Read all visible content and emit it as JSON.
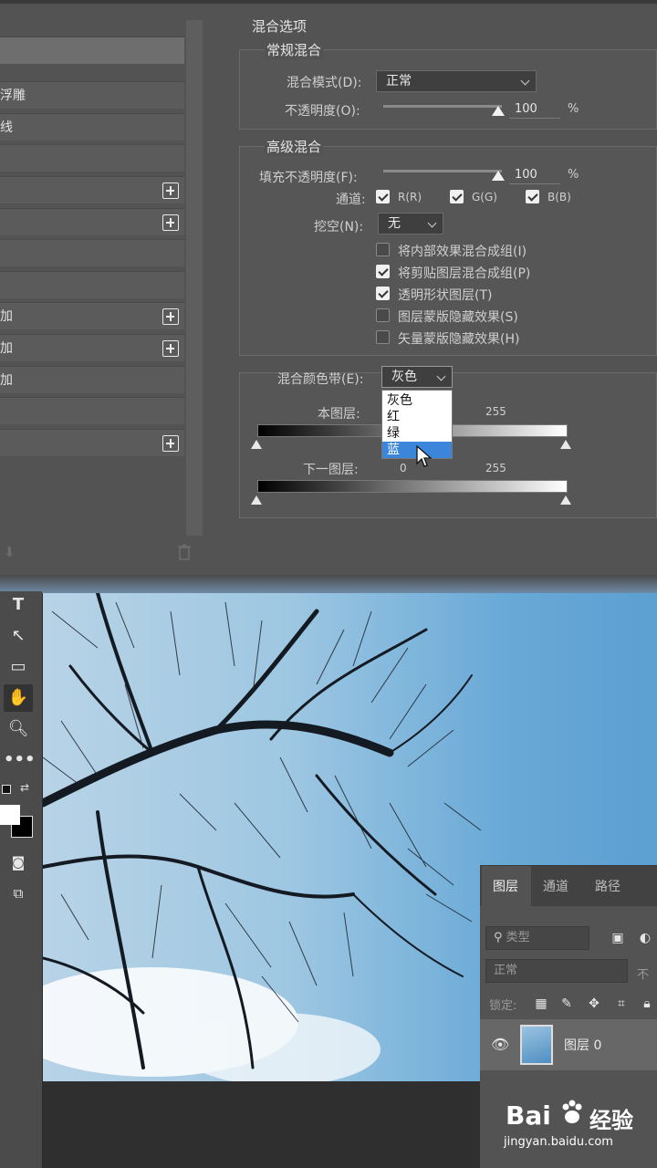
{
  "style_list": {
    "items": [
      {
        "label": "",
        "plus": false,
        "selected": true
      },
      {
        "label": "浮雕",
        "plus": false
      },
      {
        "label": "线",
        "plus": false
      },
      {
        "label": "",
        "plus": false
      },
      {
        "label": "",
        "plus": true
      },
      {
        "label": "",
        "plus": true
      },
      {
        "label": "",
        "plus": false
      },
      {
        "label": "",
        "plus": false
      },
      {
        "label": "加",
        "plus": true
      },
      {
        "label": "加",
        "plus": true
      },
      {
        "label": "加",
        "plus": false
      },
      {
        "label": "",
        "plus": false
      },
      {
        "label": "",
        "plus": true
      }
    ]
  },
  "blend_options": {
    "title": "混合选项",
    "general": {
      "title": "常规混合",
      "mode_label": "混合模式(D):",
      "mode_value": "正常",
      "opacity_label": "不透明度(O):",
      "opacity_value": "100",
      "opacity_unit": "%"
    },
    "advanced": {
      "title": "高级混合",
      "fill_label": "填充不透明度(F):",
      "fill_value": "100",
      "fill_unit": "%",
      "channels_label": "通道:",
      "channel_r": "R(R)",
      "channel_g": "G(G)",
      "channel_b": "B(B)",
      "knockout_label": "挖空(N):",
      "knockout_value": "无",
      "options": [
        {
          "label": "将内部效果混合成组(I)",
          "checked": false
        },
        {
          "label": "将剪贴图层混合成组(P)",
          "checked": true
        },
        {
          "label": "透明形状图层(T)",
          "checked": true
        },
        {
          "label": "图层蒙版隐藏效果(S)",
          "checked": false
        },
        {
          "label": "矢量蒙版隐藏效果(H)",
          "checked": false
        }
      ]
    },
    "blend_if": {
      "label": "混合颜色带(E):",
      "value": "灰色",
      "menu": [
        "灰色",
        "红",
        "绿",
        "蓝"
      ],
      "highlighted_index": 3,
      "this_layer_label": "本图层:",
      "this_layer_high": "255",
      "underlying_label": "下一图层:",
      "underlying_low": "0",
      "underlying_high": "255"
    }
  },
  "layers_panel": {
    "tabs": [
      "图层",
      "通道",
      "路径"
    ],
    "search_placeholder": "类型",
    "blend_mode": "正常",
    "opacity_prefix": "不",
    "lock_label": "锁定:",
    "layer_name": "图层 0"
  },
  "watermark": {
    "brand": "Bai",
    "brand_cn": "经验",
    "url": "jingyan.baidu.com"
  },
  "colors": {
    "dialog_bg": "#535353",
    "menu_highlight": "#3b86db",
    "sky_blue": "#69a9d7"
  }
}
